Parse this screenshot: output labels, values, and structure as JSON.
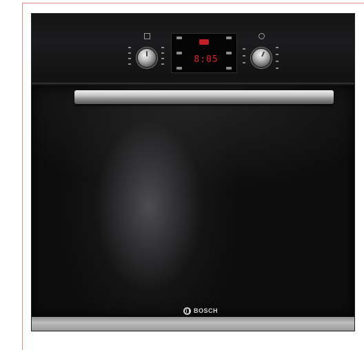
{
  "product": {
    "brand_label": "BOSCH",
    "display_time": "8:05",
    "colors": {
      "body": "#0b0b0c",
      "display_digits": "#e3202a",
      "handle": "#c9c9c9",
      "base_strip": "#bdbdbd",
      "frame_border": "#d98a8a"
    },
    "icons": [
      "oven-mode-icon",
      "temperature-icon",
      "timer-icon",
      "light-icon"
    ]
  }
}
